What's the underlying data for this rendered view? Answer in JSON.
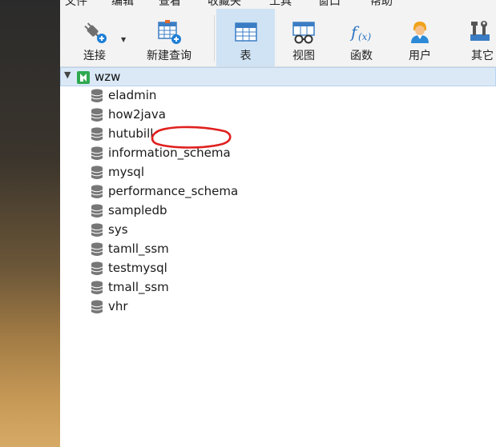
{
  "menubar": {
    "items": [
      {
        "label": "文件"
      },
      {
        "label": "编辑"
      },
      {
        "label": "查看"
      },
      {
        "label": "收藏夹"
      },
      {
        "label": "工具"
      },
      {
        "label": "窗口"
      },
      {
        "label": "帮助"
      }
    ]
  },
  "toolbar": {
    "connect": "连接",
    "new_query": "新建查询",
    "table": "表",
    "view": "视图",
    "function": "函数",
    "user": "用户",
    "other": "其它"
  },
  "tree": {
    "connection": "wzw",
    "databases": [
      "eladmin",
      "how2java",
      "hutubill",
      "information_schema",
      "mysql",
      "performance_schema",
      "sampledb",
      "sys",
      "tamll_ssm",
      "testmysql",
      "tmall_ssm",
      "vhr"
    ]
  },
  "colors": {
    "active_tool": "#cfe3f5",
    "selection": "#dbe9f7",
    "annotation": "#e0201e"
  }
}
